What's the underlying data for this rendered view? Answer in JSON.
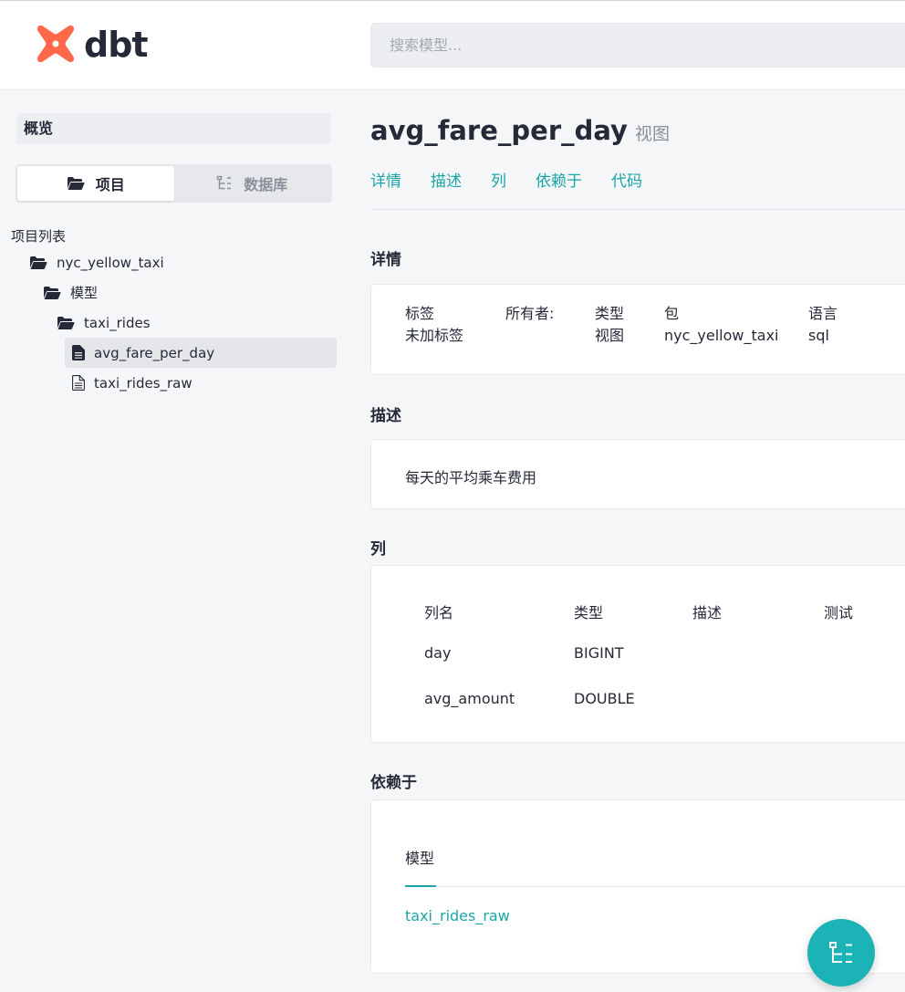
{
  "header": {
    "logo_text": "dbt",
    "search_placeholder": "搜索模型..."
  },
  "sidebar": {
    "overview_label": "概览",
    "switch": {
      "project_label": "项目",
      "database_label": "数据库",
      "active": "project"
    },
    "tree_title": "项目列表",
    "tree": [
      {
        "label": "nyc_yellow_taxi",
        "icon": "folder-open-icon",
        "level": 0
      },
      {
        "label": "模型",
        "icon": "folder-open-icon",
        "level": 1
      },
      {
        "label": "taxi_rides",
        "icon": "folder-open-icon",
        "level": 2
      },
      {
        "label": "avg_fare_per_day",
        "icon": "file-filled-icon",
        "level": 3,
        "selected": true
      },
      {
        "label": "taxi_rides_raw",
        "icon": "file-outline-icon",
        "level": 3
      }
    ]
  },
  "main": {
    "title": "avg_fare_per_day",
    "type_label": "视图",
    "tabs": [
      "详情",
      "描述",
      "列",
      "依赖于",
      "代码"
    ],
    "details": {
      "heading": "详情",
      "fields": [
        {
          "label": "标签",
          "value": "未加标签"
        },
        {
          "label": "所有者:",
          "value": ""
        },
        {
          "label": "类型",
          "value": "视图"
        },
        {
          "label": "包",
          "value": "nyc_yellow_taxi"
        },
        {
          "label": "语言",
          "value": "sql"
        }
      ]
    },
    "description": {
      "heading": "描述",
      "text": "每天的平均乘车费用"
    },
    "columns": {
      "heading": "列",
      "headers": [
        "列名",
        "类型",
        "描述",
        "测试"
      ],
      "rows": [
        [
          "day",
          "BIGINT",
          "",
          ""
        ],
        [
          "avg_amount",
          "DOUBLE",
          "",
          ""
        ]
      ]
    },
    "depends_on": {
      "heading": "依赖于",
      "tab_label": "模型",
      "items": [
        "taxi_rides_raw"
      ]
    }
  },
  "colors": {
    "accent": "#1ba5a8",
    "logo": "#ff694a",
    "text": "#262a38"
  }
}
